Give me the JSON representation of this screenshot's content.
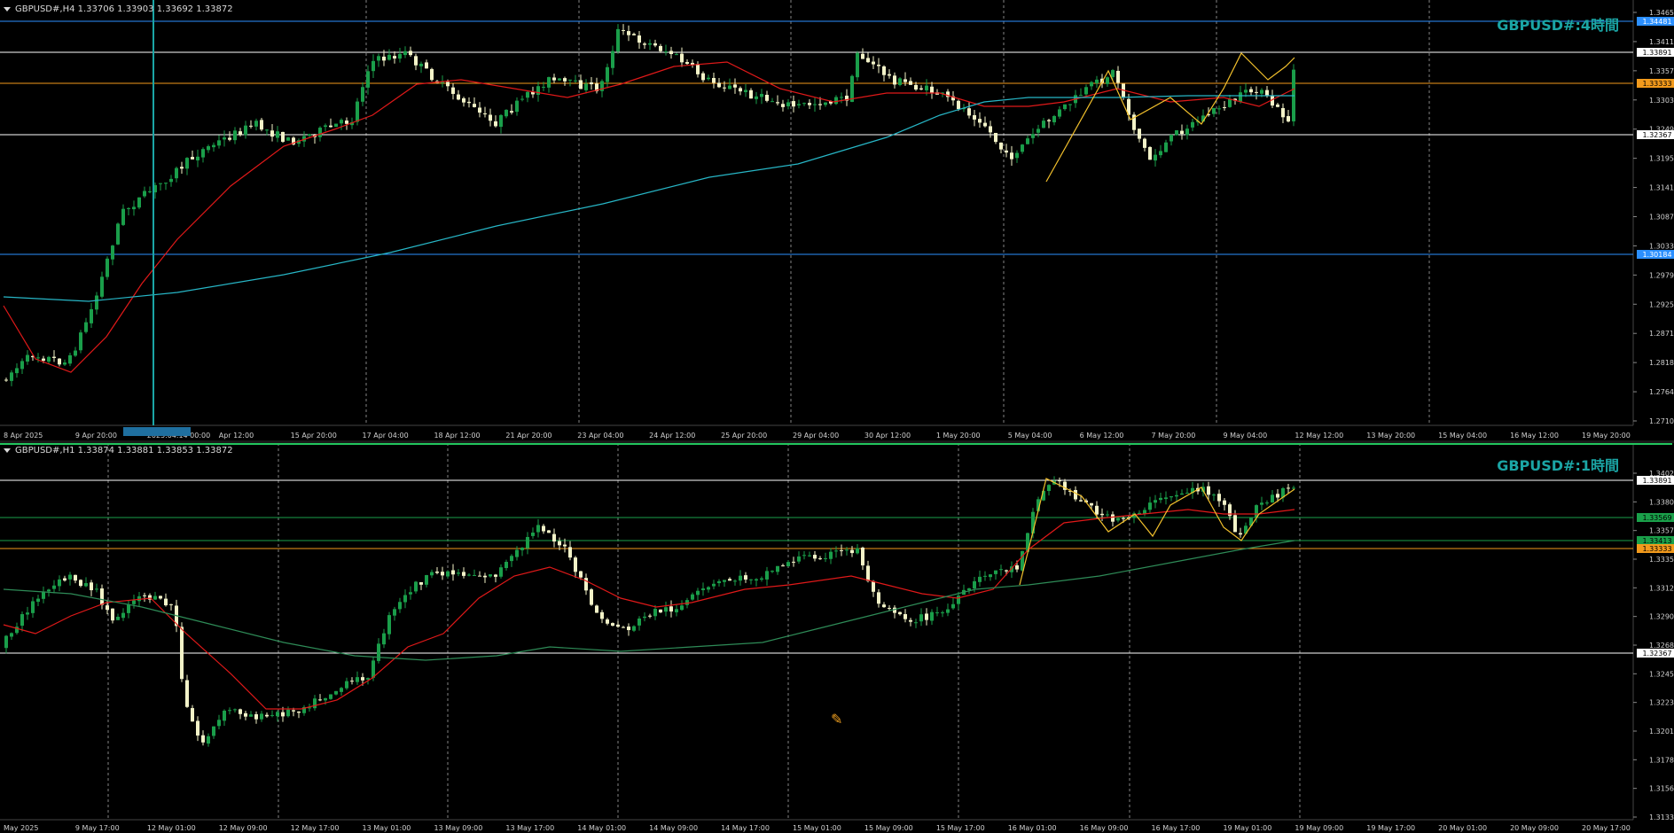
{
  "colors": {
    "background": "#000000",
    "bull_candle": "#1a9e4a",
    "bear_candle": "#f3f3c8",
    "ma_fast": "#e01919",
    "ma_slow_top": "#27b6c6",
    "ma_slow_bottom": "#2e8b57",
    "zigzag": "#f2c02c",
    "level_white": "#ffffff",
    "level_orange": "#f29a1c",
    "level_blue": "#2b8fff",
    "level_green": "#1aa04a",
    "title_color": "#1ba5a5"
  },
  "top_chart": {
    "header": "GBPUSD#,H4  1.33706 1.33903 1.33692 1.33872",
    "title": "GBPUSD#:4時間",
    "price_ticks": [
      "1.34650",
      "1.34110",
      "1.33570",
      "1.33030",
      "1.32490",
      "1.31950",
      "1.31410",
      "1.30870",
      "1.30330",
      "1.29790",
      "1.29250",
      "1.28710",
      "1.28185",
      "1.27645",
      "1.27105"
    ],
    "time_labels": [
      "8 Apr 2025",
      "9 Apr 20:00",
      "2025.04.14 00:00",
      "Apr 12:00",
      "15 Apr 20:00",
      "17 Apr 04:00",
      "18 Apr 12:00",
      "21 Apr 20:00",
      "23 Apr 04:00",
      "24 Apr 12:00",
      "25 Apr 20:00",
      "29 Apr 04:00",
      "30 Apr 12:00",
      "1 May 20:00",
      "5 May 04:00",
      "6 May 12:00",
      "7 May 20:00",
      "9 May 04:00",
      "12 May 12:00",
      "13 May 20:00",
      "15 May 04:00",
      "16 May 12:00",
      "19 May 20:00"
    ],
    "level_labels": [
      {
        "text": "1.34481",
        "color": "#2b8fff"
      },
      {
        "text": "1.33891",
        "color": "#ffffff"
      },
      {
        "text": "1.33333",
        "color": "#f29a1c"
      },
      {
        "text": "1.32367",
        "color": "#ffffff"
      },
      {
        "text": "1.30184",
        "color": "#2b8fff"
      }
    ]
  },
  "bottom_chart": {
    "header": "GBPUSD#,H1  1.33874 1.33881 1.33853 1.33872",
    "title": "GBPUSD#:1時間",
    "price_ticks": [
      "1.34025",
      "1.33800",
      "1.33575",
      "1.33350",
      "1.33125",
      "1.32905",
      "1.32680",
      "1.32455",
      "1.32235",
      "1.32010",
      "1.31785",
      "1.31560",
      "1.31335"
    ],
    "time_labels": [
      "May 2025",
      "9 May 17:00",
      "12 May 01:00",
      "12 May 09:00",
      "12 May 17:00",
      "13 May 01:00",
      "13 May 09:00",
      "13 May 17:00",
      "14 May 01:00",
      "14 May 09:00",
      "14 May 17:00",
      "15 May 01:00",
      "15 May 09:00",
      "15 May 17:00",
      "16 May 01:00",
      "16 May 09:00",
      "16 May 17:00",
      "19 May 01:00",
      "19 May 09:00",
      "19 May 17:00",
      "20 May 01:00",
      "20 May 09:00",
      "20 May 17:00"
    ],
    "level_labels": [
      {
        "text": "1.33891",
        "color": "#ffffff"
      },
      {
        "text": "1.33569",
        "color": "#1aa04a"
      },
      {
        "text": "1.33413",
        "color": "#1aa04a"
      },
      {
        "text": "1.33333",
        "color": "#f29a1c"
      },
      {
        "text": "1.32367",
        "color": "#ffffff"
      }
    ]
  }
}
